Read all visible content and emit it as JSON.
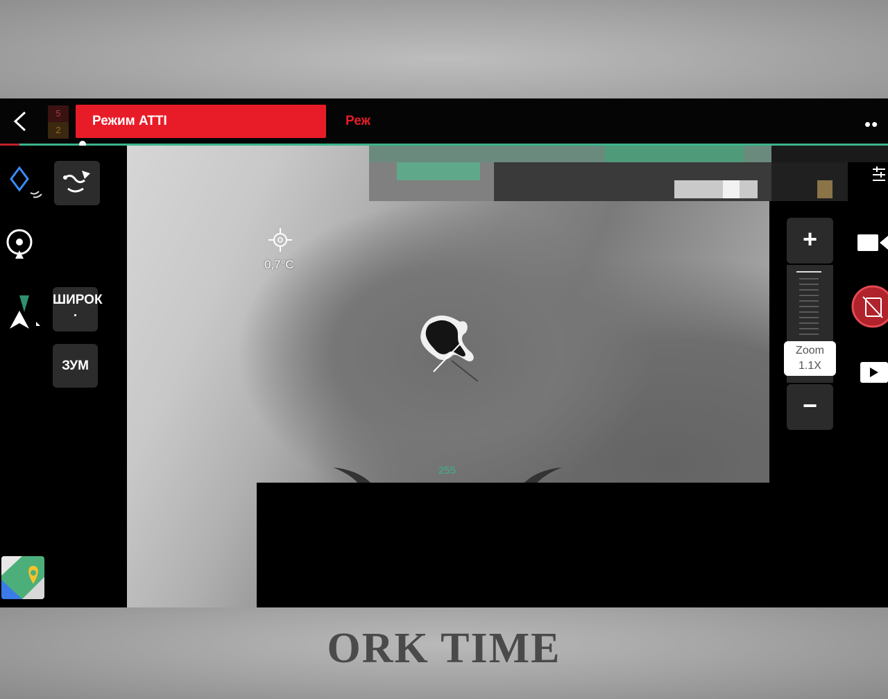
{
  "topbar": {
    "mode_banner": "Режим ATTI",
    "mode_banner_repeat": "Реж",
    "signal_top": "5",
    "signal_bottom": "2",
    "more": "••"
  },
  "feed": {
    "temperature": "0,7°C",
    "center_value": "255"
  },
  "left_controls": {
    "wide_button": "ШИРОК",
    "wide_button_dot": ".",
    "zoom_button": "ЗУМ"
  },
  "zoom": {
    "plus": "+",
    "minus": "−",
    "label": "Zoom",
    "value": "1.1X"
  },
  "watermark": "ORK TIME",
  "colors": {
    "atti_red": "#e81c28",
    "progress_green": "#3bb48c",
    "record_red": "#b0222c"
  }
}
